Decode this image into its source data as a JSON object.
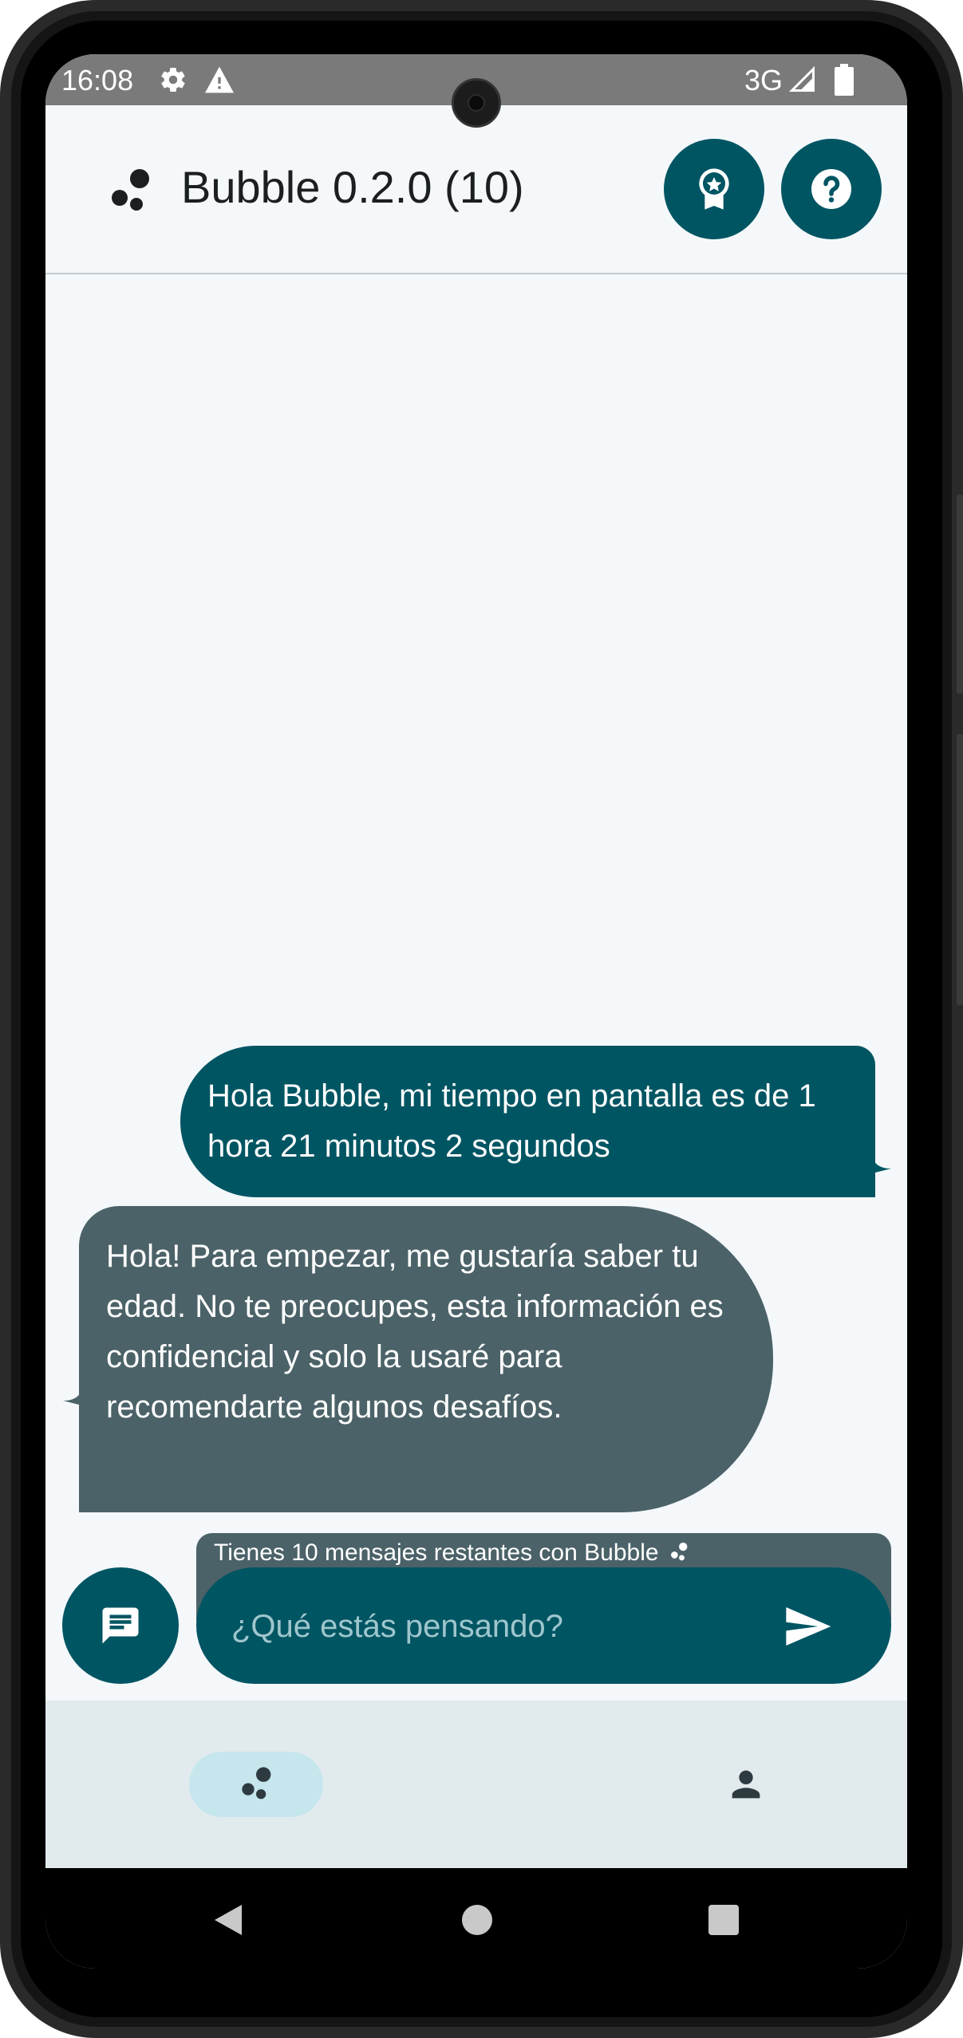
{
  "status_bar": {
    "time": "16:08",
    "network": "3G",
    "icons": [
      "gear-icon",
      "warning-icon",
      "signal-icon",
      "battery-icon"
    ]
  },
  "app_bar": {
    "title": "Bubble 0.2.0 (10)",
    "logo_icon": "bubble-logo-icon",
    "actions": [
      {
        "name": "achievements-button",
        "icon": "award-icon"
      },
      {
        "name": "help-button",
        "icon": "help-icon"
      }
    ]
  },
  "messages": [
    {
      "sender": "user",
      "text": "Hola Bubble, mi tiempo en pantalla es de 1 hora 21 minutos 2 segundos"
    },
    {
      "sender": "bot",
      "text": "Hola! Para empezar, me gustaría saber tu edad. No te preocupes, esta información es confidencial y solo la usaré para recomendarte algunos desafíos."
    }
  ],
  "composer": {
    "remaining_text": "Tienes 10 mensajes restantes con Bubble",
    "placeholder": "¿Qué estás pensando?",
    "value": "",
    "send_icon": "send-icon",
    "chat_icon": "chat-icon"
  },
  "bottom_nav": {
    "items": [
      {
        "name": "nav-bubble",
        "icon": "bubble-logo-icon",
        "selected": true
      },
      {
        "name": "nav-profile",
        "icon": "person-icon",
        "selected": false
      }
    ]
  },
  "system_nav": {
    "items": [
      "back-icon",
      "home-icon",
      "recents-icon"
    ]
  },
  "colors": {
    "primary": "#005563",
    "bot_bubble": "#4b6268",
    "background": "#f4f8fa",
    "nav_background": "#e1ebed",
    "nav_selected": "#c6e6ee"
  }
}
